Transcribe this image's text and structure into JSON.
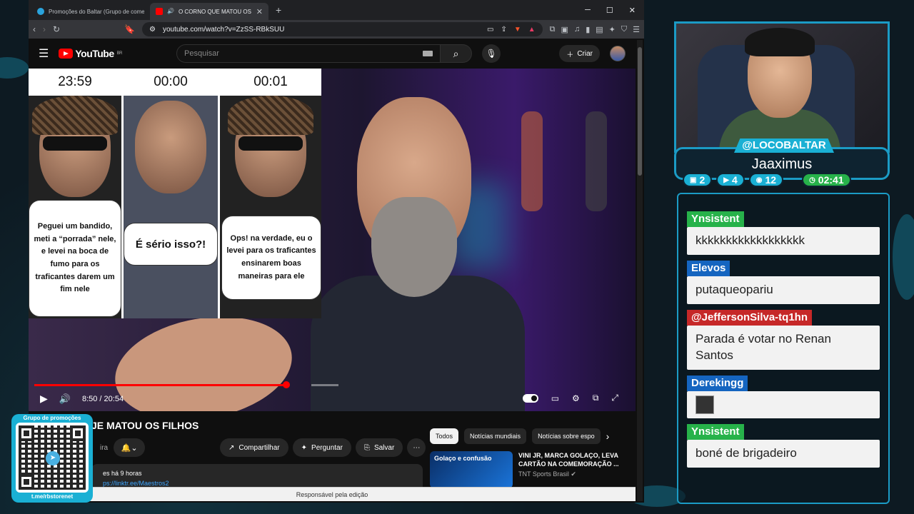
{
  "browser": {
    "tabs": [
      {
        "label": "Promoções do Baltar (Grupo de comentários",
        "active": false
      },
      {
        "label": "O CORNO QUE MATOU OS FILHOS",
        "active": true
      }
    ],
    "new_tab": "+",
    "url": "youtube.com/watch?v=ZzSS-RBkSUU",
    "status": "Responsável pela edição"
  },
  "youtube": {
    "logo": "YouTube",
    "region": "BR",
    "search_placeholder": "Pesquisar",
    "create_label": "Criar",
    "video": {
      "meme": {
        "panels": [
          {
            "time": "23:59",
            "caption": "Peguei um bandido, meti a “porrada” nele, e levei na boca de fumo para os traficantes darem um fim nele"
          },
          {
            "time": "00:00",
            "caption": "É sério isso?!"
          },
          {
            "time": "00:01",
            "caption": "Ops! na verdade, eu o levei para os traficantes ensinarem boas maneiras para ele"
          }
        ]
      },
      "time_current": "8:50",
      "time_total": "20:54",
      "time_display": "8:50 / 20:54",
      "progress_fraction": 0.423
    },
    "title_visible": "JE MATOU OS FILHOS",
    "channel_partial": "ira",
    "actions": {
      "share": "Compartilhar",
      "ask": "Perguntar",
      "save": "Salvar",
      "more": "⋯"
    },
    "description": {
      "age": "es  há 9 horas",
      "link": "ps://linktr.ee/Maestros2"
    },
    "chips": [
      "Todos",
      "Notícias mundiais",
      "Notícias sobre espo"
    ],
    "recommendation": {
      "thumb_text": "Golaço e confusão",
      "title": "VINI JR, MARCA GOLAÇO, LEVA CARTÃO NA COMEMORAÇÃO ...",
      "channel": "TNT Sports Brasil"
    }
  },
  "overlay": {
    "handle": "@LOCOBALTAR",
    "nick": "Jaaximus",
    "stats": [
      {
        "icon": "twitch-icon",
        "value": "2"
      },
      {
        "icon": "youtube-icon",
        "value": "4"
      },
      {
        "icon": "kick-icon",
        "value": "12"
      }
    ],
    "timer": "02:41",
    "colors": {
      "accent": "#1ab0d4",
      "timer": "#27b24a"
    },
    "chat": [
      {
        "author": "Ynsistent",
        "color": "#27b24a",
        "text": "kkkkkkkkkkkkkkkkkk"
      },
      {
        "author": "Elevos",
        "color": "#1565c0",
        "text": "putaqueopariu"
      },
      {
        "author": "@JeffersonSilva-tq1hn",
        "color": "#c62828",
        "text": "Parada é votar no Renan Santos"
      },
      {
        "author": "Derekingg",
        "color": "#1565c0",
        "text": ""
      },
      {
        "author": "Ynsistent",
        "color": "#27b24a",
        "text": "boné de brigadeiro"
      }
    ],
    "promo": {
      "title": "Grupo de promoções",
      "link": "t.me/rbstorenet"
    }
  }
}
